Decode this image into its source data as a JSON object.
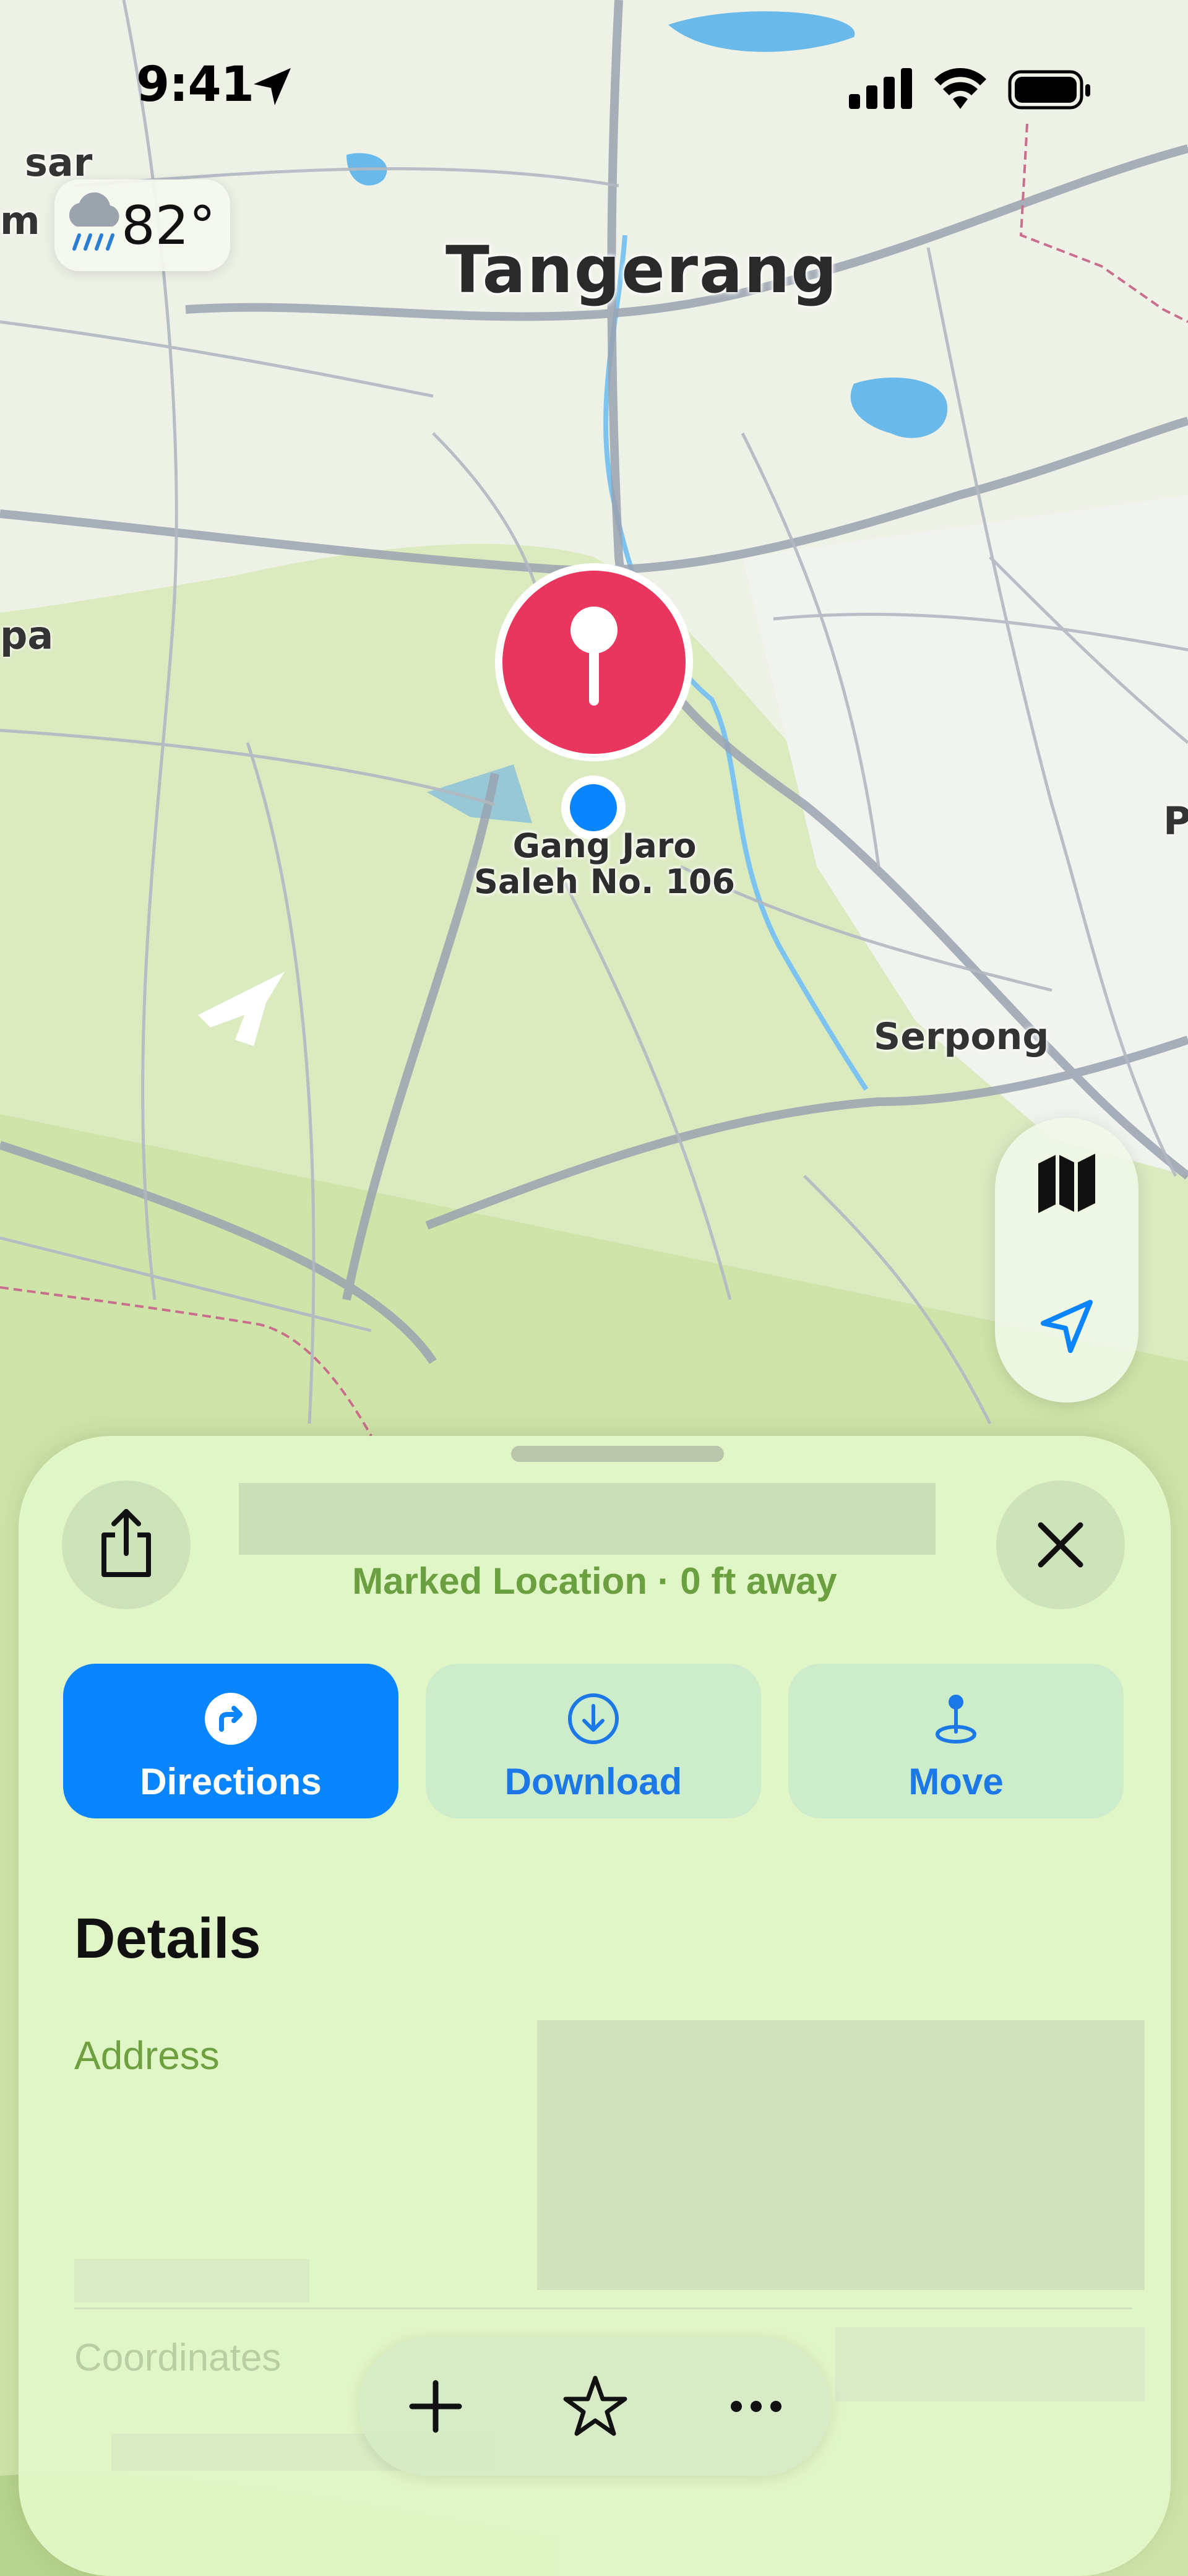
{
  "status_bar": {
    "time": "9:41"
  },
  "weather": {
    "temperature": "82°",
    "icon": "cloud-rain-icon"
  },
  "map": {
    "labels": {
      "tangerang": "Tangerang",
      "serpong": "Serpong",
      "pin_label_line1": "Gang Jaro",
      "pin_label_line2": "Saleh No. 106",
      "edge_sar": "sar",
      "edge_m": "m",
      "edge_pa": "pa",
      "edge_p": "P"
    },
    "controls": {
      "map_mode_icon": "map-icon",
      "locate_icon": "location-arrow-icon"
    },
    "colors": {
      "pin": "#e8365e",
      "user_dot": "#0a84ff"
    }
  },
  "sheet": {
    "subtitle": "Marked Location · 0 ft away",
    "actions": [
      {
        "label": "Directions",
        "icon": "directions-icon"
      },
      {
        "label": "Download",
        "icon": "download-icon"
      },
      {
        "label": "Move",
        "icon": "move-pin-icon"
      }
    ],
    "details_heading": "Details",
    "address_label": "Address",
    "coordinates_label": "Coordinates",
    "toolbar": {
      "add_icon": "plus-icon",
      "favorite_icon": "star-icon",
      "more_icon": "ellipsis-icon"
    },
    "accent": "#0a84ff"
  }
}
